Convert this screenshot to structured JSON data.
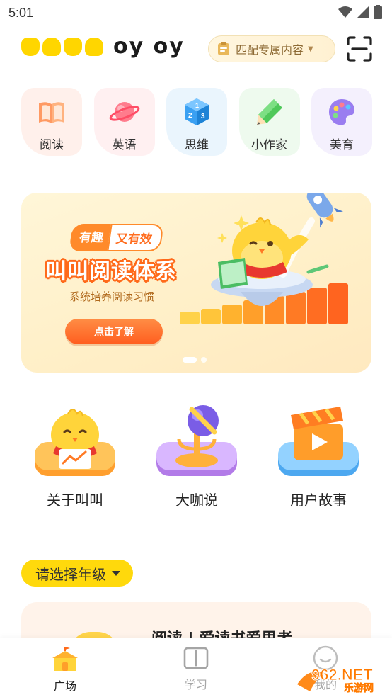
{
  "status_bar": {
    "time": "5:01",
    "icons": [
      "wifi-icon",
      "signal-icon",
      "battery-icon"
    ]
  },
  "header": {
    "logo_icon": "dodo-logo-icon",
    "logo_text": "oy oy",
    "match_button": "匹配专属内容",
    "scan_icon": "scan-icon"
  },
  "categories": [
    {
      "label": "阅读",
      "icon": "book-icon",
      "bg": "#fff0eb"
    },
    {
      "label": "英语",
      "icon": "planet-icon",
      "bg": "#fff0f1"
    },
    {
      "label": "思维",
      "icon": "dice-icon",
      "bg": "#eaf5fd"
    },
    {
      "label": "小作家",
      "icon": "pencil-icon",
      "bg": "#eefaee"
    },
    {
      "label": "美育",
      "icon": "palette-icon",
      "bg": "#f4f0fd"
    }
  ],
  "banner": {
    "tag_a": "有趣",
    "tag_b": "又有效",
    "title": "叫叫阅读体系",
    "subtitle": "系统培养阅读习惯",
    "button": "点击了解",
    "slides": 2,
    "active_slide": 1
  },
  "features": [
    {
      "label": "关于叫叫",
      "icon": "chick-mascot-icon"
    },
    {
      "label": "大咖说",
      "icon": "microphone-icon"
    },
    {
      "label": "用户故事",
      "icon": "video-clapper-icon"
    }
  ],
  "grade_selector": {
    "label": "请选择年级"
  },
  "card": {
    "title": "阅读 | 爱读书爱思考"
  },
  "bottom_nav": [
    {
      "label": "广场",
      "icon": "home-icon",
      "active": true
    },
    {
      "label": "学习",
      "icon": "book-icon",
      "active": false
    },
    {
      "label": "我的",
      "icon": "profile-icon",
      "active": false
    }
  ],
  "watermark": {
    "text_top": "962.NET",
    "text_bottom": "乐游网"
  },
  "colors": {
    "accent_yellow": "#ffd90c",
    "accent_orange": "#ff6a1a",
    "banner_bg": "#fff2cf"
  }
}
